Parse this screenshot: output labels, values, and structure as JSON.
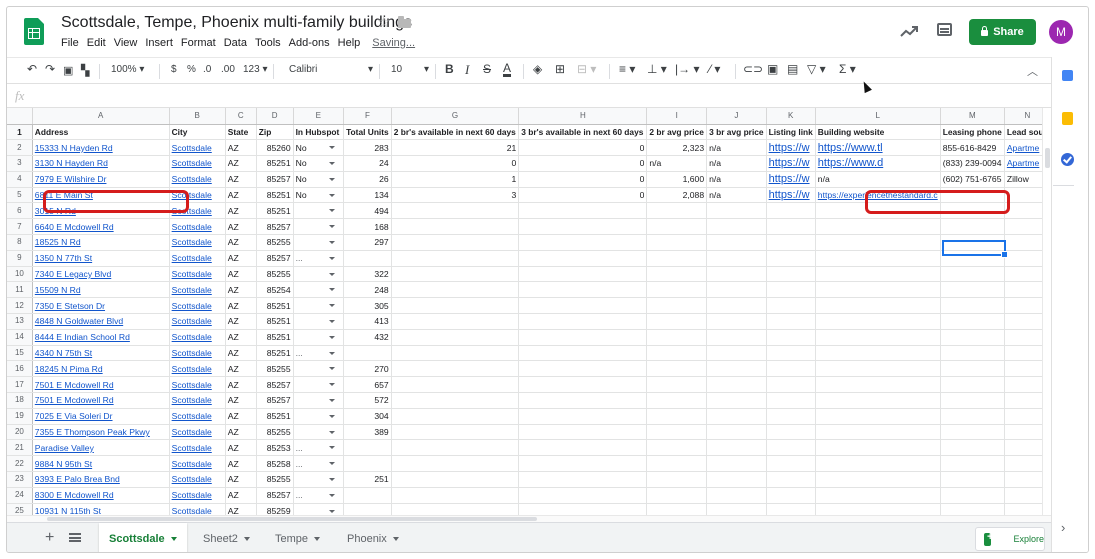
{
  "header": {
    "title": "Scottsdale, Tempe, Phoenix multi-family buildings",
    "menu": [
      "File",
      "Edit",
      "View",
      "Insert",
      "Format",
      "Data",
      "Tools",
      "Add-ons",
      "Help"
    ],
    "saving": "Saving...",
    "share_label": "Share",
    "avatar_letter": "M",
    "accent_color": "#1a8e3e"
  },
  "toolbar": {
    "zoom": "100%",
    "currency": "$",
    "percent": "%",
    "dec_less": ".0",
    "dec_more": ".00",
    "more_formats": "123",
    "font": "Calibri",
    "font_size": "10",
    "bold": "B",
    "italic": "I",
    "strike": "S",
    "text_color": "A",
    "sigma": "Σ"
  },
  "formula": {
    "fx": "fx"
  },
  "columns": [
    "A",
    "B",
    "C",
    "D",
    "E",
    "F",
    "G",
    "H",
    "I",
    "J",
    "K",
    "L",
    "M",
    "N"
  ],
  "header_row": [
    "Address",
    "City",
    "State",
    "Zip",
    "In Hubspot",
    "Total Units",
    "2 br's available in next 60 days",
    "3 br's available in next 60 days",
    "2 br avg price",
    "3 br avg price",
    "Listing link",
    "Building website",
    "Leasing phone",
    "Lead sou"
  ],
  "rows": [
    {
      "n": "2",
      "cells": [
        "15333 N Hayden Rd",
        "Scottsdale",
        "AZ",
        "85260",
        "No",
        "283",
        "21",
        "0",
        "2,323",
        "n/a",
        "https://w",
        "https://www.tl",
        "855-616-8429",
        "Apartme"
      ]
    },
    {
      "n": "3",
      "cells": [
        "3130 N Hayden Rd",
        "Scottsdale",
        "AZ",
        "85251",
        "No",
        "24",
        "0",
        "0",
        "n/a",
        "n/a",
        "https://w",
        "https://www.d",
        "(833) 239-0094",
        "Apartme"
      ]
    },
    {
      "n": "4",
      "cells": [
        "7979 E Wilshire Dr",
        "Scottsdale",
        "AZ",
        "85257",
        "No",
        "26",
        "1",
        "0",
        "1,600",
        "n/a",
        "https://w",
        "n/a",
        "(602) 751-6765",
        "Zillow"
      ]
    },
    {
      "n": "5",
      "cells": [
        "6811 E Main St",
        "Scottsdale",
        "AZ",
        "85251",
        "No",
        "134",
        "3",
        "0",
        "2,088",
        "n/a",
        "https://w",
        "https://experiencethestandard.c",
        "",
        ""
      ]
    },
    {
      "n": "6",
      "cells": [
        "3015 N  Rd",
        "Scottsdale",
        "AZ",
        "85251",
        "",
        "494",
        "",
        "",
        "",
        "",
        "",
        "",
        "",
        ""
      ]
    },
    {
      "n": "7",
      "cells": [
        "6640 E Mcdowell Rd",
        "Scottsdale",
        "AZ",
        "85257",
        "",
        "168",
        "",
        "",
        "",
        "",
        "",
        "",
        "",
        ""
      ]
    },
    {
      "n": "8",
      "cells": [
        "18525 N  Rd",
        "Scottsdale",
        "AZ",
        "85255",
        "",
        "297",
        "",
        "",
        "",
        "",
        "",
        "",
        "",
        ""
      ]
    },
    {
      "n": "9",
      "cells": [
        "1350 N 77th St",
        "Scottsdale",
        "AZ",
        "85257",
        "...",
        "",
        "",
        "",
        "",
        "",
        "",
        "",
        "",
        ""
      ]
    },
    {
      "n": "10",
      "cells": [
        "7340 E Legacy Blvd",
        "Scottsdale",
        "AZ",
        "85255",
        "",
        "322",
        "",
        "",
        "",
        "",
        "",
        "",
        "",
        ""
      ]
    },
    {
      "n": "11",
      "cells": [
        "15509 N  Rd",
        "Scottsdale",
        "AZ",
        "85254",
        "",
        "248",
        "",
        "",
        "",
        "",
        "",
        "",
        "",
        ""
      ]
    },
    {
      "n": "12",
      "cells": [
        "7350 E Stetson Dr",
        "Scottsdale",
        "AZ",
        "85251",
        "",
        "305",
        "",
        "",
        "",
        "",
        "",
        "",
        "",
        ""
      ]
    },
    {
      "n": "13",
      "cells": [
        "4848 N Goldwater Blvd",
        "Scottsdale",
        "AZ",
        "85251",
        "",
        "413",
        "",
        "",
        "",
        "",
        "",
        "",
        "",
        ""
      ]
    },
    {
      "n": "14",
      "cells": [
        "8444 E Indian School Rd",
        "Scottsdale",
        "AZ",
        "85251",
        "",
        "432",
        "",
        "",
        "",
        "",
        "",
        "",
        "",
        ""
      ]
    },
    {
      "n": "15",
      "cells": [
        "4340 N 75th St",
        "Scottsdale",
        "AZ",
        "85251",
        "...",
        "",
        "",
        "",
        "",
        "",
        "",
        "",
        "",
        ""
      ]
    },
    {
      "n": "16",
      "cells": [
        "18245 N Pima Rd",
        "Scottsdale",
        "AZ",
        "85255",
        "",
        "270",
        "",
        "",
        "",
        "",
        "",
        "",
        "",
        ""
      ]
    },
    {
      "n": "17",
      "cells": [
        "7501 E Mcdowell Rd",
        "Scottsdale",
        "AZ",
        "85257",
        "",
        "657",
        "",
        "",
        "",
        "",
        "",
        "",
        "",
        ""
      ]
    },
    {
      "n": "18",
      "cells": [
        "7501 E Mcdowell Rd",
        "Scottsdale",
        "AZ",
        "85257",
        "",
        "572",
        "",
        "",
        "",
        "",
        "",
        "",
        "",
        ""
      ]
    },
    {
      "n": "19",
      "cells": [
        "7025 E Via Soleri Dr",
        "Scottsdale",
        "AZ",
        "85251",
        "",
        "304",
        "",
        "",
        "",
        "",
        "",
        "",
        "",
        ""
      ]
    },
    {
      "n": "20",
      "cells": [
        "7355 E Thompson Peak Pkwy",
        "Scottsdale",
        "AZ",
        "85255",
        "",
        "389",
        "",
        "",
        "",
        "",
        "",
        "",
        "",
        ""
      ]
    },
    {
      "n": "21",
      "cells": [
        "Paradise Valley",
        "Scottsdale",
        "AZ",
        "85253",
        "...",
        "",
        "",
        "",
        "",
        "",
        "",
        "",
        "",
        ""
      ]
    },
    {
      "n": "22",
      "cells": [
        "9884 N 95th St",
        "Scottsdale",
        "AZ",
        "85258",
        "...",
        "",
        "",
        "",
        "",
        "",
        "",
        "",
        "",
        ""
      ]
    },
    {
      "n": "23",
      "cells": [
        "9393 E Palo Brea Bnd",
        "Scottsdale",
        "AZ",
        "85255",
        "",
        "251",
        "",
        "",
        "",
        "",
        "",
        "",
        "",
        ""
      ]
    },
    {
      "n": "24",
      "cells": [
        "8300 E Mcdowell Rd",
        "Scottsdale",
        "AZ",
        "85257",
        "...",
        "",
        "",
        "",
        "",
        "",
        "",
        "",
        "",
        ""
      ]
    },
    {
      "n": "25",
      "cells": [
        "10931 N 115th St",
        "Scottsdale",
        "AZ",
        "85259",
        "",
        "",
        "",
        "",
        "",
        "",
        "",
        "",
        "",
        ""
      ]
    }
  ],
  "tabs": [
    {
      "label": "Scottsdale",
      "active": true
    },
    {
      "label": "Sheet2",
      "active": false
    },
    {
      "label": "Tempe",
      "active": false
    },
    {
      "label": "Phoenix",
      "active": false
    }
  ],
  "explore_label": "Explore",
  "highlight_color": "#d51c1c"
}
